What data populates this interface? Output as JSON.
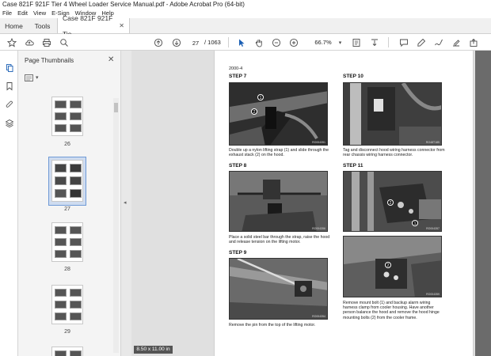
{
  "window": {
    "title": "Case 821F 921F Tier 4 Wheel Loader Service Manual.pdf - Adobe Acrobat Pro (64-bit)"
  },
  "menu": [
    "File",
    "Edit",
    "View",
    "E-Sign",
    "Window",
    "Help"
  ],
  "tabs": {
    "home": "Home",
    "tools": "Tools",
    "document": "Case 821F 921F Tie..."
  },
  "toolbar": {
    "current_page": "27",
    "total_pages": "/ 1063",
    "zoom": "66.7%"
  },
  "thumbnail_panel": {
    "title": "Page Thumbnails",
    "thumbnails": [
      {
        "label": "26",
        "selected": false
      },
      {
        "label": "27",
        "selected": true
      },
      {
        "label": "28",
        "selected": false
      },
      {
        "label": "29",
        "selected": false
      }
    ]
  },
  "page": {
    "section": "2000-4",
    "steps": [
      {
        "heading": "STEP 7",
        "photo_code": "RO004351",
        "caption": "Double up a nylon lifting strap (1) and slide through the exhaust stack (2) on the hood.",
        "callouts": [
          "1",
          "2"
        ]
      },
      {
        "heading": "STEP 8",
        "photo_code": "RO004356",
        "caption": "Place a solid steel bar through the strap, raise the hood and release tension on the lifting motor.",
        "callouts": []
      },
      {
        "heading": "STEP 9",
        "photo_code": "RO004354",
        "caption": "Remove the pin from the top of the lifting motor.",
        "callouts": []
      },
      {
        "heading": "STEP 10",
        "photo_code": "RO48T185",
        "caption": "Tag and disconnect hood wiring harness connector from rear chassis wiring harness connector.",
        "callouts": []
      },
      {
        "heading": "STEP 11",
        "photo_code": "RO004357",
        "caption": "",
        "callouts": [
          "2",
          "1"
        ]
      },
      {
        "heading": "",
        "photo_code": "RO004359",
        "caption": "Remove mount bolt (1) and backup alarm wiring harness clamp from cooler housing. Have another person balance the hood and remove the hood hinge mounting bolts (2) from the cooler frame.",
        "callouts": [
          "2"
        ]
      }
    ]
  },
  "status": {
    "page_size": "8.50 x 11.00 in"
  }
}
